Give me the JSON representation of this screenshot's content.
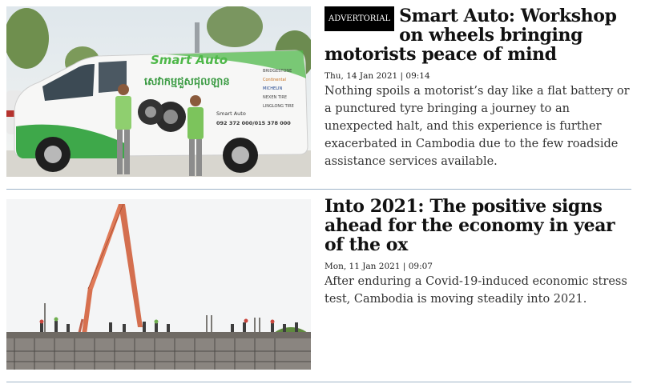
{
  "articles": [
    {
      "badge": "ADVERTORIAL",
      "headline": "Smart Auto: Workshop on wheels bringing motorists peace of mind",
      "datetime": "Thu, 14 Jan 2021 | 09:14",
      "summary": "Nothing spoils a motorist’s day like a flat battery or a punctured tyre bringing a journey to an unexpected halt, and this experience is further exacerbated in Cambodia due to the few roadside assistance services available.",
      "image": {
        "brand_text": "Smart Auto",
        "khmer_text": "សេវាកម្មជួសជុលឡាន",
        "contact_name": "Smart Auto",
        "phone": "092 372 000/015 378 000",
        "sponsor_logos": [
          "BRIDGESTONE",
          "Continental",
          "MICHELIN",
          "NEXEN TIRE",
          "LINGLONG TIRE"
        ]
      }
    },
    {
      "headline": "Into 2021: The positive signs ahead for the economy in year of the ox",
      "datetime": "Mon, 11 Jan 2021 | 09:07",
      "summary": "After enduring a Covid-19-induced economic stress test, Cambodia is moving steadily into 2021."
    }
  ]
}
